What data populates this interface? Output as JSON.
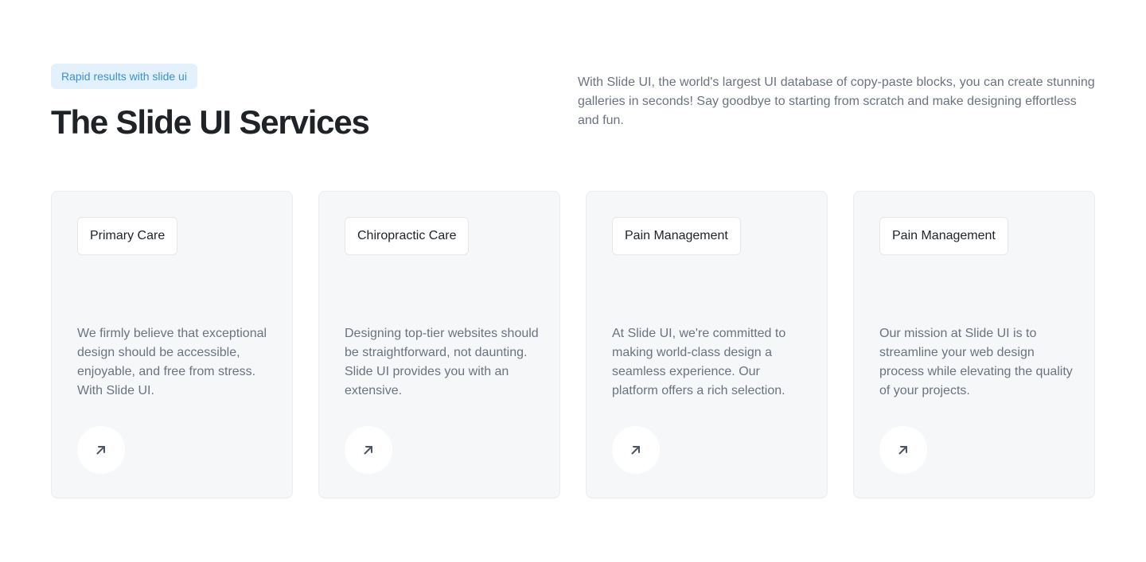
{
  "header": {
    "badge": "Rapid results with slide ui",
    "title": "The Slide UI Services",
    "intro": "With Slide UI, the world's largest UI database of copy-paste blocks, you can create stunning galleries in seconds! Say goodbye to starting from scratch and make designing effortless and fun."
  },
  "cards": [
    {
      "tag": "Primary Care",
      "text": "We firmly believe that exceptional design should be accessible, enjoyable, and free from stress. With Slide UI.",
      "icon": "arrow-up-right-icon"
    },
    {
      "tag": "Chiropractic Care",
      "text": "Designing top-tier websites should be straightforward, not daunting. Slide UI provides you with an extensive.",
      "icon": "arrow-up-right-icon"
    },
    {
      "tag": "Pain Management",
      "text": "At Slide UI, we're committed to making world-class design a seamless experience. Our platform offers a rich selection.",
      "icon": "arrow-up-right-icon"
    },
    {
      "tag": "Pain Management",
      "text": "Our mission at Slide UI is to streamline your web design process while elevating the quality of your projects.",
      "icon": "arrow-up-right-icon"
    }
  ],
  "colors": {
    "badge_bg": "#e3f1fc",
    "badge_text": "#3d8fd6",
    "card_bg": "#f6f7f9",
    "title": "#1f2328",
    "body_text": "#6b7280"
  }
}
